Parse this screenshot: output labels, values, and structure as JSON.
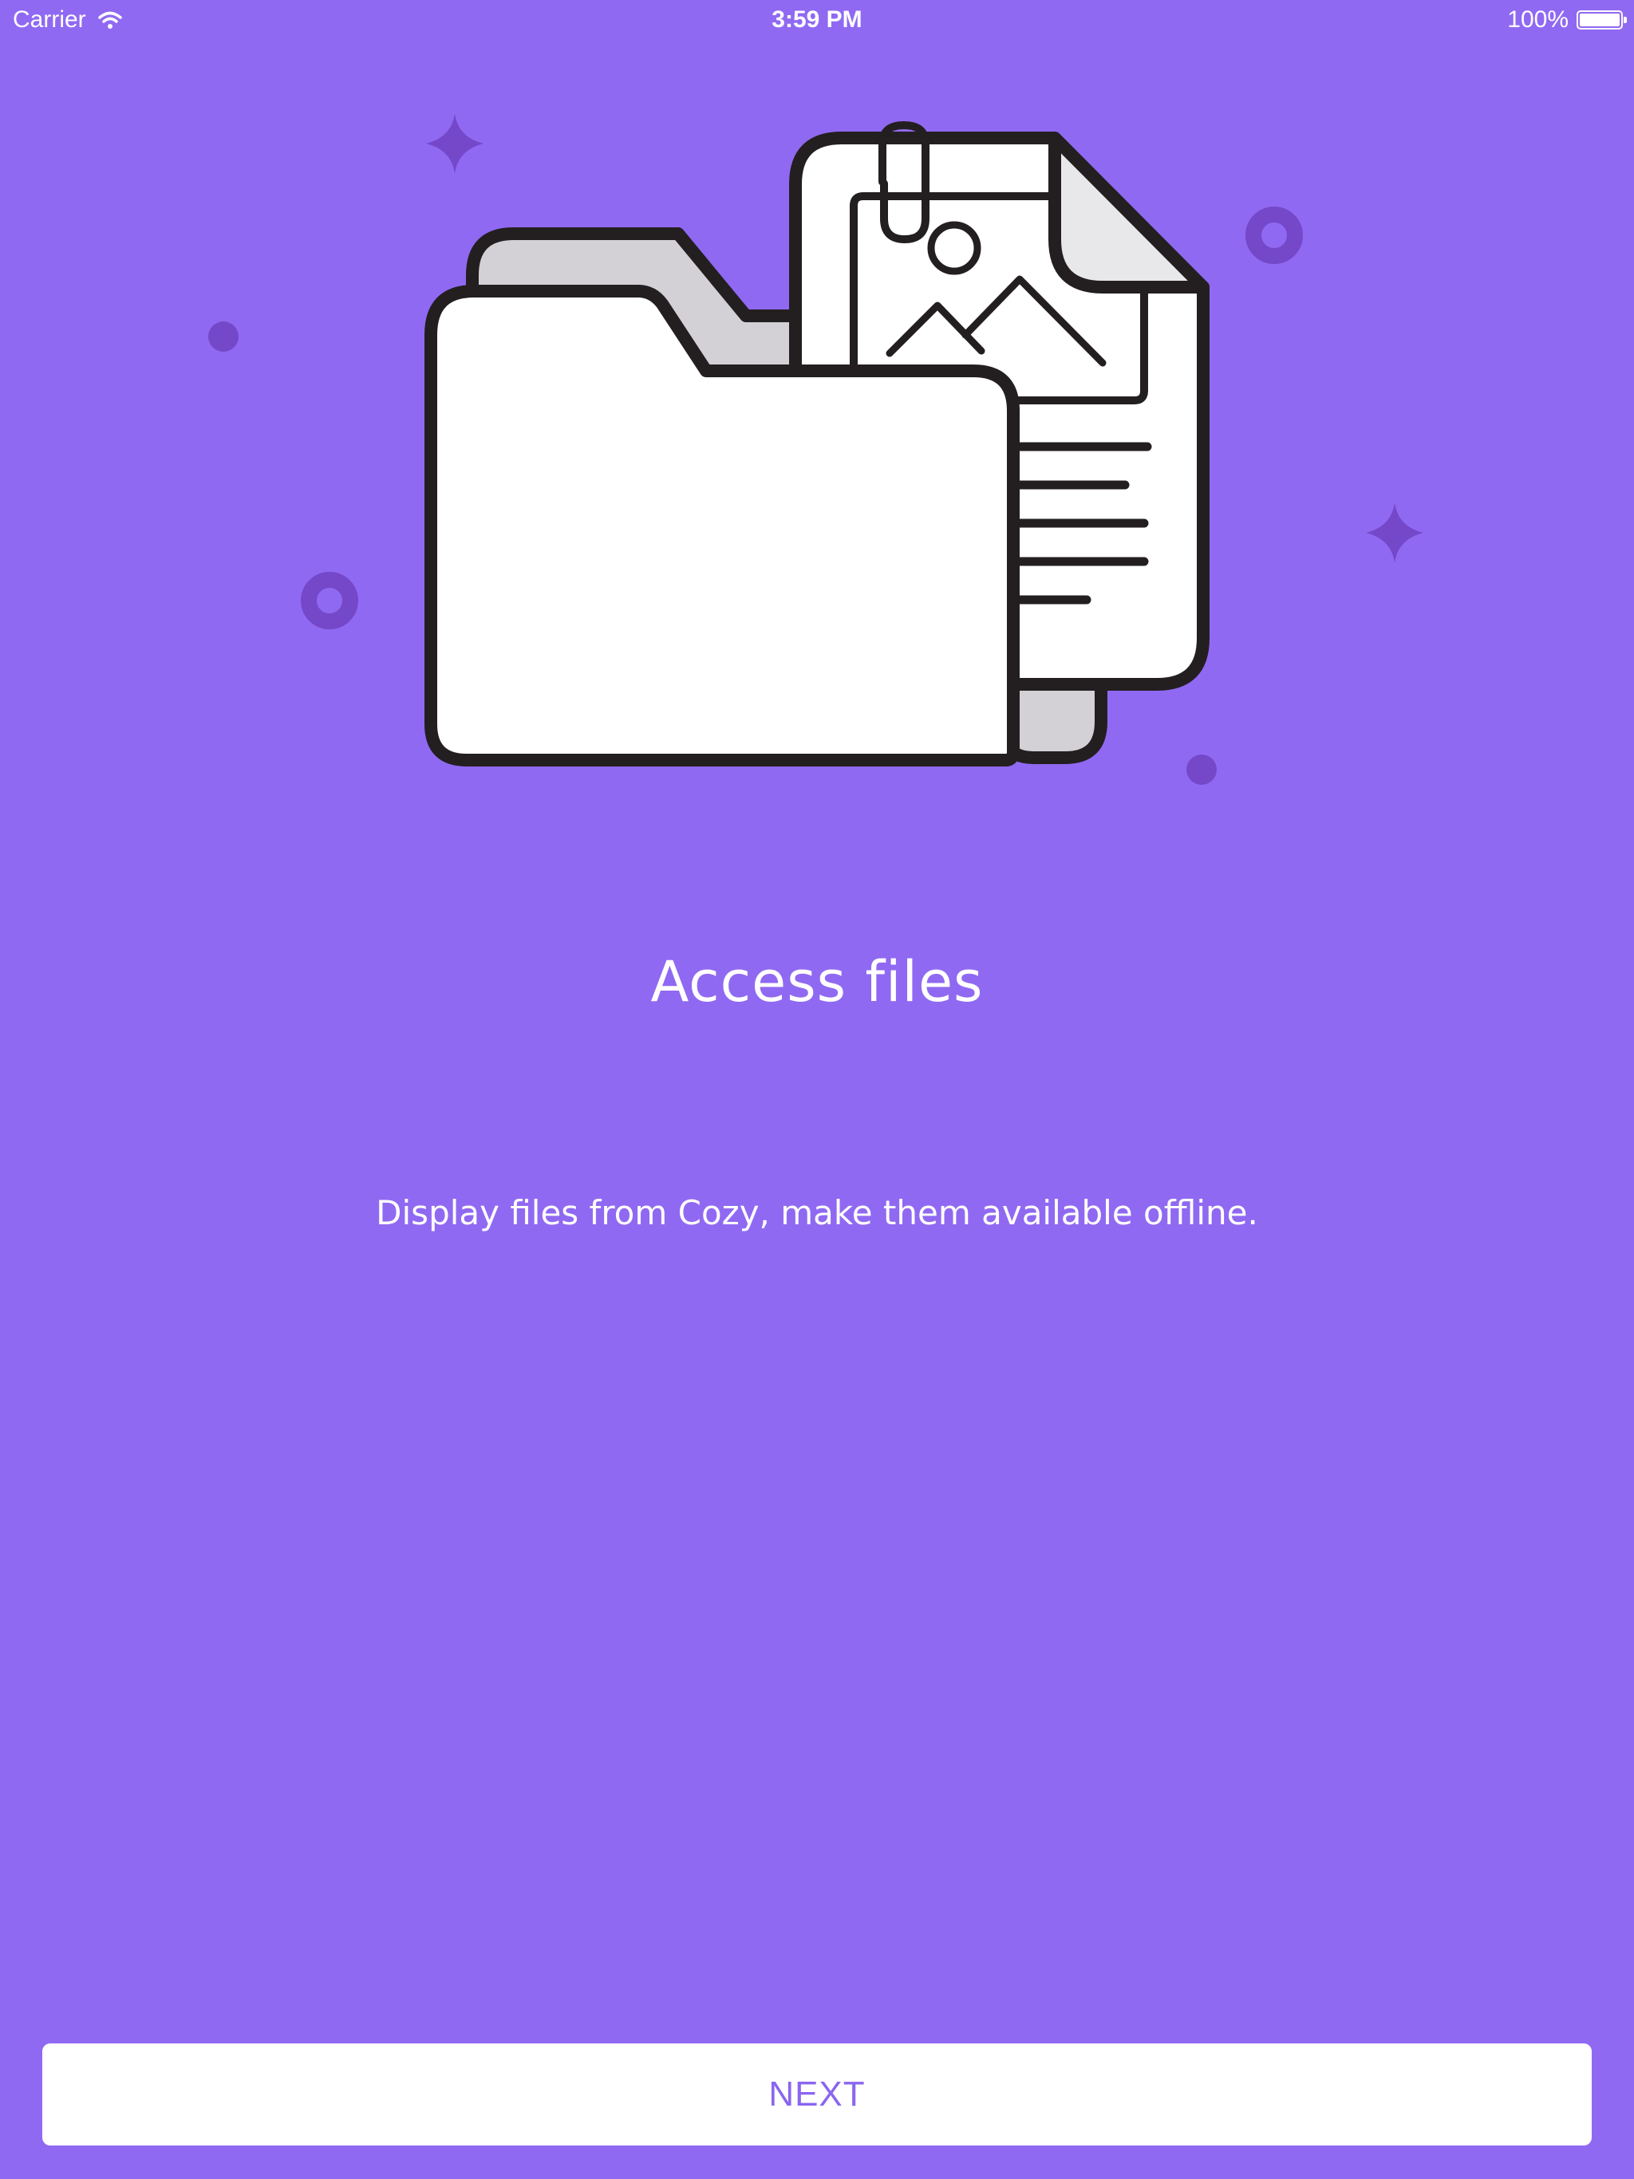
{
  "status_bar": {
    "carrier": "Carrier",
    "time": "3:59 PM",
    "battery": "100%",
    "battery_level": 1.0
  },
  "icons": {
    "wifi": "wifi-icon",
    "battery": "battery-icon",
    "illustration": "folder-with-image-document-icon"
  },
  "onboarding": {
    "title": "Access files",
    "description": "Display files from Cozy, make them available offline.",
    "next_label": "NEXT"
  },
  "colors": {
    "background": "#9069f2",
    "decoration": "#7448c8",
    "accent_text": "#8a66ef",
    "button_bg": "#ffffff"
  }
}
